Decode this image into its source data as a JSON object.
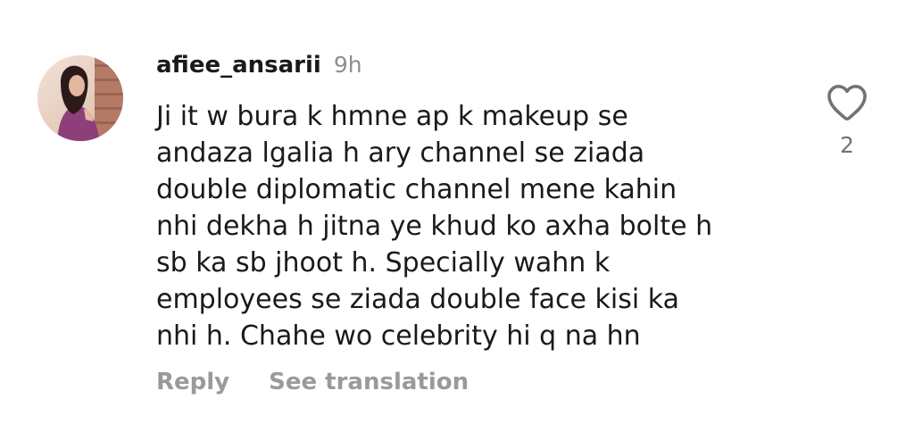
{
  "comment": {
    "username": "afiee_ansarii",
    "timestamp": "9h",
    "lines": [
      "Ji it w bura k hmne ap k makeup se",
      "andaza lgalia h ary channel se ziada",
      "double diplomatic channel mene kahin",
      "nhi dekha h jitna ye khud ko axha bolte h",
      "sb ka sb jhoot h. Specially wahn k",
      "employees se ziada double face kisi ka",
      "nhi h. Chahe wo celebrity hi q na hn"
    ],
    "actions": {
      "reply_label": "Reply",
      "translate_label": "See translation"
    },
    "likes": {
      "count": "2",
      "icon": "heart-outline-icon"
    }
  },
  "colors": {
    "text": "#1a1a1a",
    "muted": "#8e8e8e",
    "action": "#9a9a9a",
    "background": "#ffffff"
  }
}
